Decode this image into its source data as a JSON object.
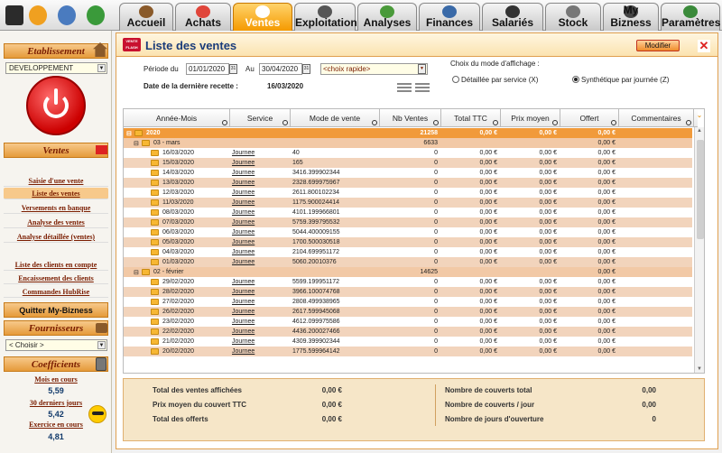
{
  "topbar": {
    "tabs": [
      {
        "label": "Accueil"
      },
      {
        "label": "Achats"
      },
      {
        "label": "Ventes"
      },
      {
        "label": "Exploitation"
      },
      {
        "label": "Analyses"
      },
      {
        "label": "Finances"
      },
      {
        "label": "Salariés"
      },
      {
        "label": "Stock"
      },
      {
        "label": "My Bizness"
      },
      {
        "label": "Paramètres"
      }
    ],
    "active_tab": "Ventes"
  },
  "sidebar": {
    "etablissement_title": "Etablissement",
    "etablissement_value": "DEVELOPPEMENT",
    "ventes_title": "Ventes",
    "ventes_links": [
      "Saisie d'une vente",
      "Liste des ventes",
      "Versements en banque",
      "Analyse des ventes",
      "Analyse détaillée (ventes)"
    ],
    "other_links": [
      "Liste des clients en compte",
      "Encaissement des clients",
      "Commandes HubRise"
    ],
    "quit_label": "Quitter My-Bizness",
    "fournisseurs_title": "Fournisseurs",
    "fournisseurs_value": "< Choisir >",
    "coefficients_title": "Coefficients",
    "coef": [
      {
        "label": "Mois en cours",
        "value": "5,59"
      },
      {
        "label": "30 derniers jours",
        "value": "5,42"
      },
      {
        "label": "Exercice en cours",
        "value": "4,81"
      }
    ]
  },
  "main": {
    "logo_text": "VENTE FLASH",
    "title": "Liste des ventes",
    "modify_label": "Modifier",
    "close_label": "✕",
    "periode_label": "Période du",
    "date_from": "01/01/2020",
    "au_label": "Au",
    "date_to": "30/04/2020",
    "quick_choice": "<choix rapide>",
    "last_receipt_label": "Date de la dernière recette :",
    "last_receipt_value": "16/03/2020",
    "display_mode_label": "Choix du mode d'affichage :",
    "mode_detail": "Détaillée par service (X)",
    "mode_synth": "Synthétique par journée (Z)"
  },
  "grid": {
    "columns": [
      "Année-Mois",
      "Service",
      "Mode de vente",
      "Nb Ventes",
      "Total TTC",
      "Prix moyen",
      "Offert",
      "Commentaires"
    ],
    "year_row": {
      "label": "2020",
      "nb": "21258",
      "ttc": "0,00 €",
      "prix": "0,00 €",
      "offert": "0,00 €"
    },
    "months": [
      {
        "label": "03 - mars",
        "nb": "6633",
        "offert": "0,00 €",
        "rows": [
          [
            "16/03/2020",
            "Journee",
            "40",
            "0",
            "0,00 €",
            "0,00 €",
            "0,00 €"
          ],
          [
            "15/03/2020",
            "Journee",
            "165",
            "0",
            "0,00 €",
            "0,00 €",
            "0,00 €"
          ],
          [
            "14/03/2020",
            "Journee",
            "3416.399902344",
            "0",
            "0,00 €",
            "0,00 €",
            "0,00 €"
          ],
          [
            "13/03/2020",
            "Journee",
            "2328.699975967",
            "0",
            "0,00 €",
            "0,00 €",
            "0,00 €"
          ],
          [
            "12/03/2020",
            "Journee",
            "2611.800102234",
            "0",
            "0,00 €",
            "0,00 €",
            "0,00 €"
          ],
          [
            "11/03/2020",
            "Journee",
            "1175.900024414",
            "0",
            "0,00 €",
            "0,00 €",
            "0,00 €"
          ],
          [
            "08/03/2020",
            "Journee",
            "4101.199966801",
            "0",
            "0,00 €",
            "0,00 €",
            "0,00 €"
          ],
          [
            "07/03/2020",
            "Journee",
            "5759.399795532",
            "0",
            "0,00 €",
            "0,00 €",
            "0,00 €"
          ],
          [
            "06/03/2020",
            "Journee",
            "5044.400009155",
            "0",
            "0,00 €",
            "0,00 €",
            "0,00 €"
          ],
          [
            "05/03/2020",
            "Journee",
            "1700.500030518",
            "0",
            "0,00 €",
            "0,00 €",
            "0,00 €"
          ],
          [
            "04/03/2020",
            "Journee",
            "2104.699951172",
            "0",
            "0,00 €",
            "0,00 €",
            "0,00 €"
          ],
          [
            "01/03/2020",
            "Journee",
            "5060.20010376",
            "0",
            "0,00 €",
            "0,00 €",
            "0,00 €"
          ]
        ]
      },
      {
        "label": "02 - février",
        "nb": "14625",
        "offert": "0,00 €",
        "rows": [
          [
            "29/02/2020",
            "Journee",
            "5599.199951172",
            "0",
            "0,00 €",
            "0,00 €",
            "0,00 €"
          ],
          [
            "28/02/2020",
            "Journee",
            "3966.100074768",
            "0",
            "0,00 €",
            "0,00 €",
            "0,00 €"
          ],
          [
            "27/02/2020",
            "Journee",
            "2808.499938965",
            "0",
            "0,00 €",
            "0,00 €",
            "0,00 €"
          ],
          [
            "26/02/2020",
            "Journee",
            "2617.599945068",
            "0",
            "0,00 €",
            "0,00 €",
            "0,00 €"
          ],
          [
            "23/02/2020",
            "Journee",
            "4612.099975586",
            "0",
            "0,00 €",
            "0,00 €",
            "0,00 €"
          ],
          [
            "22/02/2020",
            "Journee",
            "4436.200027466",
            "0",
            "0,00 €",
            "0,00 €",
            "0,00 €"
          ],
          [
            "21/02/2020",
            "Journee",
            "4309.399902344",
            "0",
            "0,00 €",
            "0,00 €",
            "0,00 €"
          ],
          [
            "20/02/2020",
            "Journee",
            "1775.599964142",
            "0",
            "0,00 €",
            "0,00 €",
            "0,00 €"
          ]
        ]
      }
    ]
  },
  "summary": {
    "items_left": [
      {
        "label": "Total des ventes affichées",
        "value": "0,00 €"
      },
      {
        "label": "Prix moyen du couvert TTC",
        "value": "0,00 €"
      },
      {
        "label": "Total des offerts",
        "value": "0,00 €"
      }
    ],
    "items_right": [
      {
        "label": "Nombre de couverts total",
        "value": "0,00"
      },
      {
        "label": "Nombre de couverts / jour",
        "value": "0,00"
      },
      {
        "label": "Nombre de jours d'ouverture",
        "value": "0"
      }
    ]
  }
}
